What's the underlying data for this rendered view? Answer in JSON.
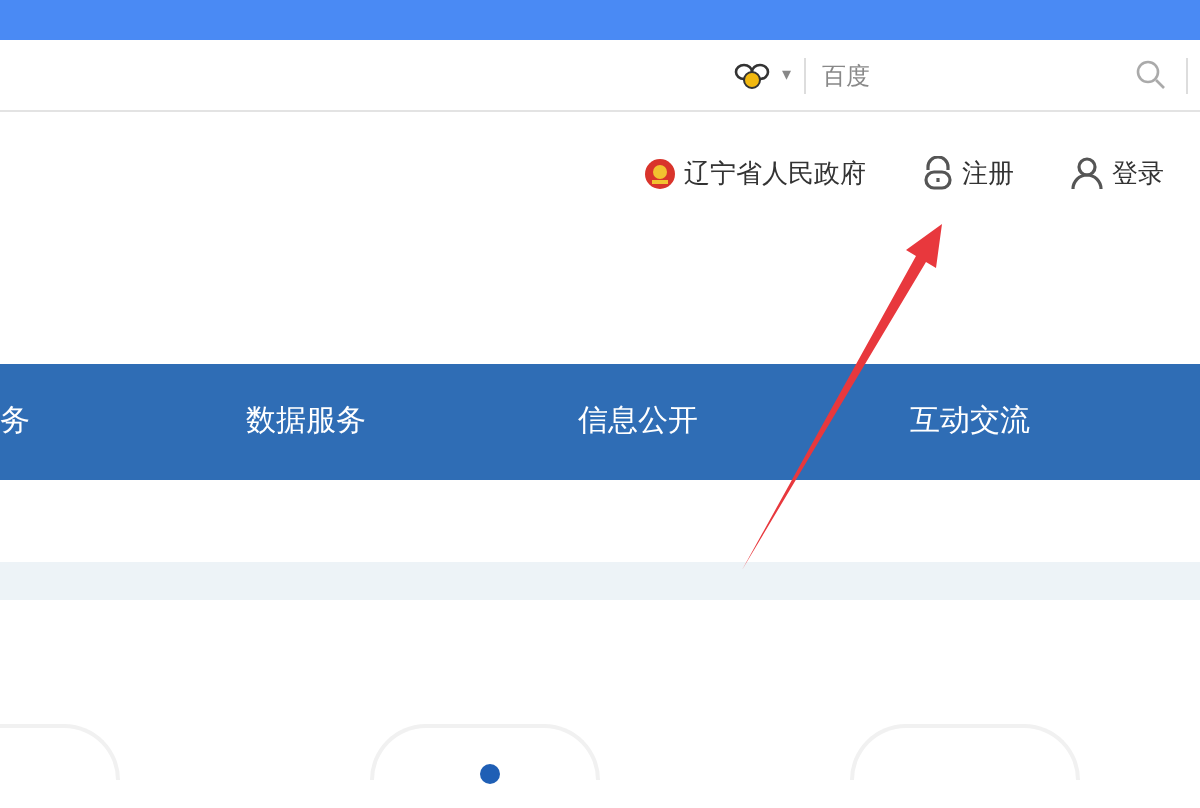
{
  "search_bar": {
    "engine_menu": "▾",
    "placeholder": "百度"
  },
  "header_links": [
    {
      "kind": "emblem",
      "label": "辽宁省人民政府"
    },
    {
      "kind": "lock",
      "label": "注册"
    },
    {
      "kind": "user",
      "label": "登录"
    }
  ],
  "nav": [
    {
      "label": "务"
    },
    {
      "label": "数据服务"
    },
    {
      "label": "信息公开"
    },
    {
      "label": "互动交流"
    }
  ]
}
